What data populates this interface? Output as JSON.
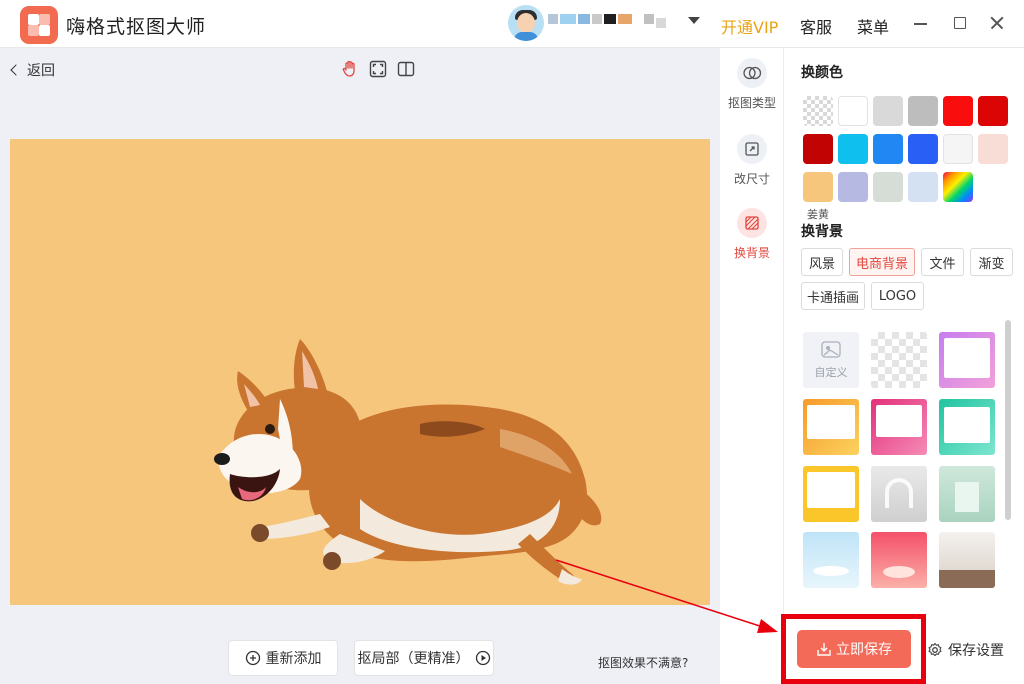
{
  "app": {
    "title": "嗨格式抠图大师"
  },
  "header": {
    "vip_label": "开通VIP",
    "service_label": "客服",
    "menu_label": "菜单"
  },
  "workspace": {
    "back_label": "返回",
    "readd_label": "重新添加",
    "partial_label": "抠局部（更精准）",
    "unsatisfied_label": "抠图效果不满意?",
    "background_color": "#f5c67c"
  },
  "toolbar": {
    "items": [
      {
        "label": "抠图类型",
        "icon": "cutout-type-icon"
      },
      {
        "label": "改尺寸",
        "icon": "resize-icon"
      },
      {
        "label": "换背景",
        "icon": "change-background-icon"
      }
    ]
  },
  "panel": {
    "color_title": "换颜色",
    "swatches": [
      "transparent",
      "#ffffff",
      "#d9d9d9",
      "#bdbdbd",
      "#fa0d0d",
      "#dc0505",
      "#c20303",
      "#0fc0ee",
      "#2187f2",
      "#2a5ff5",
      "#f5f5f5",
      "#f7ddd5",
      "#f5c67c",
      "#b6b9e2",
      "#d6ddd7",
      "#d4e1f3",
      "rainbow"
    ],
    "selected_swatch_label": "姜黄",
    "background_title": "换背景",
    "background_tabs": [
      "风景",
      "电商背景",
      "文件",
      "渐变",
      "卡通插画",
      "LOGO"
    ],
    "active_tab": "电商背景",
    "custom_label": "自定义",
    "save_label": "立即保存",
    "save_settings_label": "保存设置"
  }
}
